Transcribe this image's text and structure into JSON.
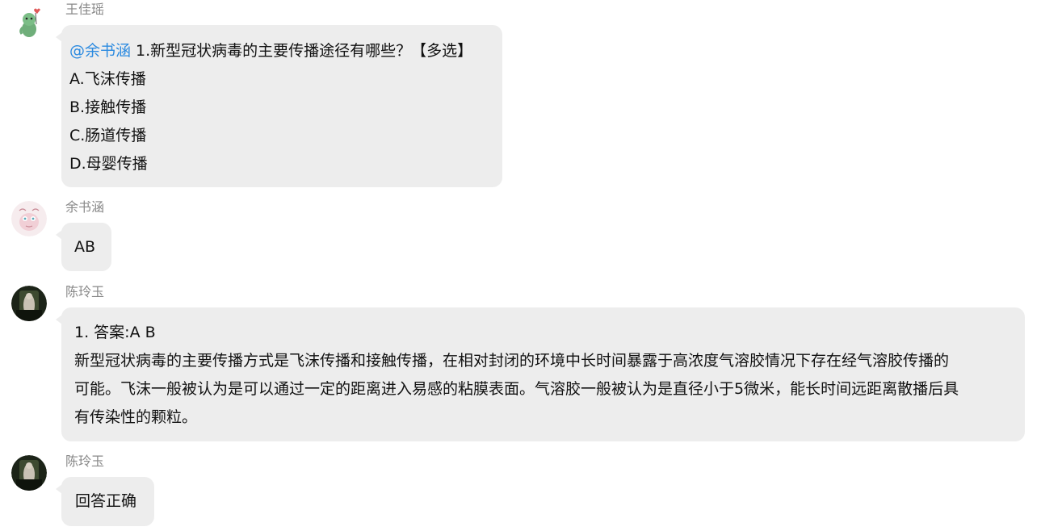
{
  "messages": [
    {
      "sender": "王佳瑶",
      "avatar_icon": "green-dinosaur-avatar",
      "mention": "@余书涵",
      "lines": [
        " 1.新型冠状病毒的主要传播途径有哪些？【多选】",
        "A.飞沫传播",
        "B.接触传播",
        "C.肠道传播",
        "D.母婴传播"
      ]
    },
    {
      "sender": "余书涵",
      "avatar_icon": "pink-cartoon-avatar",
      "text": "AB"
    },
    {
      "sender": "陈玲玉",
      "avatar_icon": "dark-photo-avatar",
      "lines": [
        "1. 答案:A B",
        "新型冠状病毒的主要传播方式是飞沫传播和接触传播，在相对封闭的环境中长时间暴露于高浓度气溶胶情况下存在经气溶胶传播的",
        "可能。飞沫一般被认为是可以通过一定的距离进入易感的粘膜表面。气溶胶一般被认为是直径小于5微米，能长时间远距离散播后具",
        "有传染性的颗粒。"
      ]
    },
    {
      "sender": "陈玲玉",
      "avatar_icon": "dark-photo-avatar",
      "text": "回答正确"
    }
  ],
  "colors": {
    "bubble": "#ededed",
    "mention": "#2b8ae0",
    "sender_name": "#888888",
    "text": "#111111"
  }
}
